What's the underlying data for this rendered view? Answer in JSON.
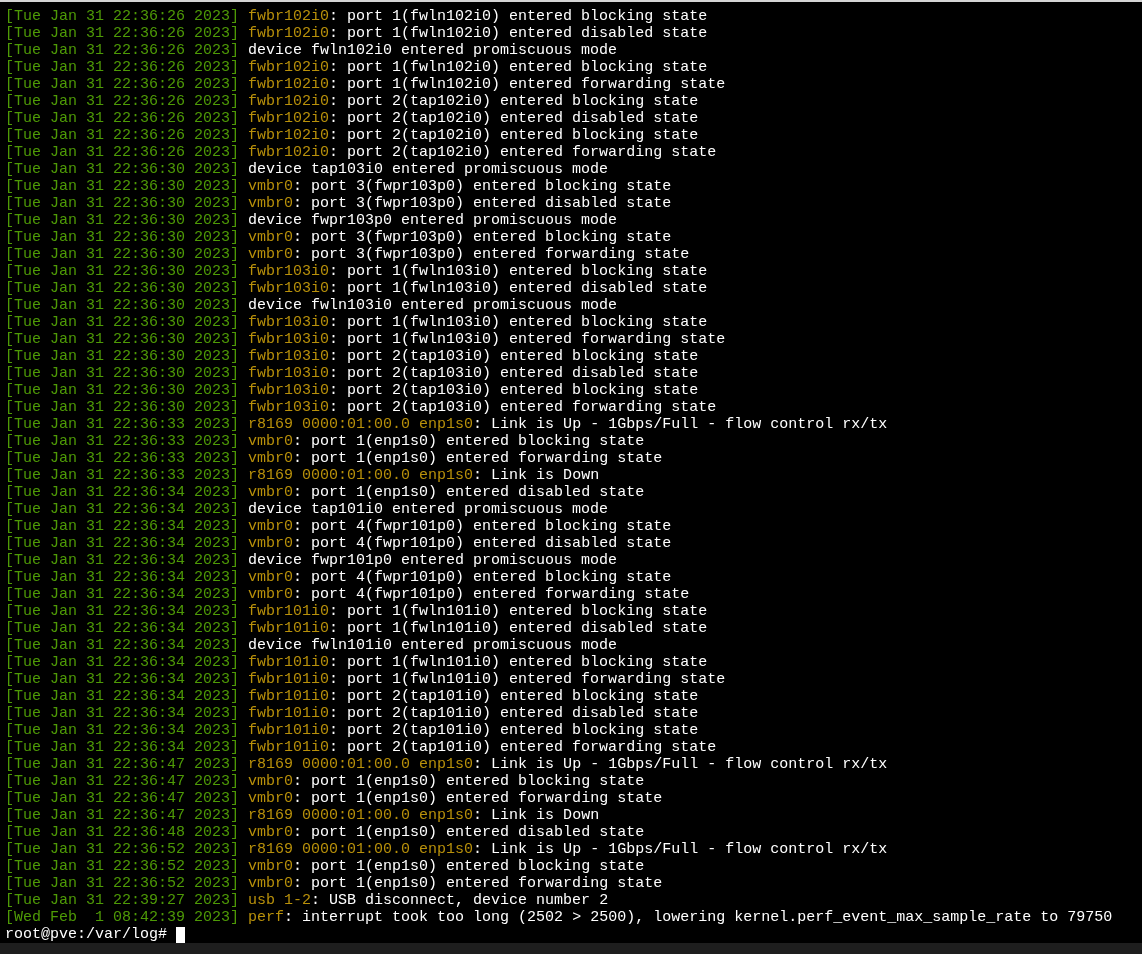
{
  "log_lines": [
    {
      "timestamp": "[Tue Jan 31 22:36:26 2023]",
      "source": "fwbr102i0",
      "message": ": port 1(fwln102i0) entered blocking state"
    },
    {
      "timestamp": "[Tue Jan 31 22:36:26 2023]",
      "source": "fwbr102i0",
      "message": ": port 1(fwln102i0) entered disabled state"
    },
    {
      "timestamp": "[Tue Jan 31 22:36:26 2023]",
      "message": "device fwln102i0 entered promiscuous mode"
    },
    {
      "timestamp": "[Tue Jan 31 22:36:26 2023]",
      "source": "fwbr102i0",
      "message": ": port 1(fwln102i0) entered blocking state"
    },
    {
      "timestamp": "[Tue Jan 31 22:36:26 2023]",
      "source": "fwbr102i0",
      "message": ": port 1(fwln102i0) entered forwarding state"
    },
    {
      "timestamp": "[Tue Jan 31 22:36:26 2023]",
      "source": "fwbr102i0",
      "message": ": port 2(tap102i0) entered blocking state"
    },
    {
      "timestamp": "[Tue Jan 31 22:36:26 2023]",
      "source": "fwbr102i0",
      "message": ": port 2(tap102i0) entered disabled state"
    },
    {
      "timestamp": "[Tue Jan 31 22:36:26 2023]",
      "source": "fwbr102i0",
      "message": ": port 2(tap102i0) entered blocking state"
    },
    {
      "timestamp": "[Tue Jan 31 22:36:26 2023]",
      "source": "fwbr102i0",
      "message": ": port 2(tap102i0) entered forwarding state"
    },
    {
      "timestamp": "[Tue Jan 31 22:36:30 2023]",
      "message": "device tap103i0 entered promiscuous mode"
    },
    {
      "timestamp": "[Tue Jan 31 22:36:30 2023]",
      "source": "vmbr0",
      "message": ": port 3(fwpr103p0) entered blocking state"
    },
    {
      "timestamp": "[Tue Jan 31 22:36:30 2023]",
      "source": "vmbr0",
      "message": ": port 3(fwpr103p0) entered disabled state"
    },
    {
      "timestamp": "[Tue Jan 31 22:36:30 2023]",
      "message": "device fwpr103p0 entered promiscuous mode"
    },
    {
      "timestamp": "[Tue Jan 31 22:36:30 2023]",
      "source": "vmbr0",
      "message": ": port 3(fwpr103p0) entered blocking state"
    },
    {
      "timestamp": "[Tue Jan 31 22:36:30 2023]",
      "source": "vmbr0",
      "message": ": port 3(fwpr103p0) entered forwarding state"
    },
    {
      "timestamp": "[Tue Jan 31 22:36:30 2023]",
      "source": "fwbr103i0",
      "message": ": port 1(fwln103i0) entered blocking state"
    },
    {
      "timestamp": "[Tue Jan 31 22:36:30 2023]",
      "source": "fwbr103i0",
      "message": ": port 1(fwln103i0) entered disabled state"
    },
    {
      "timestamp": "[Tue Jan 31 22:36:30 2023]",
      "message": "device fwln103i0 entered promiscuous mode"
    },
    {
      "timestamp": "[Tue Jan 31 22:36:30 2023]",
      "source": "fwbr103i0",
      "message": ": port 1(fwln103i0) entered blocking state"
    },
    {
      "timestamp": "[Tue Jan 31 22:36:30 2023]",
      "source": "fwbr103i0",
      "message": ": port 1(fwln103i0) entered forwarding state"
    },
    {
      "timestamp": "[Tue Jan 31 22:36:30 2023]",
      "source": "fwbr103i0",
      "message": ": port 2(tap103i0) entered blocking state"
    },
    {
      "timestamp": "[Tue Jan 31 22:36:30 2023]",
      "source": "fwbr103i0",
      "message": ": port 2(tap103i0) entered disabled state"
    },
    {
      "timestamp": "[Tue Jan 31 22:36:30 2023]",
      "source": "fwbr103i0",
      "message": ": port 2(tap103i0) entered blocking state"
    },
    {
      "timestamp": "[Tue Jan 31 22:36:30 2023]",
      "source": "fwbr103i0",
      "message": ": port 2(tap103i0) entered forwarding state"
    },
    {
      "timestamp": "[Tue Jan 31 22:36:33 2023]",
      "source": "r8169 0000:01:00.0 enp1s0",
      "message": ": Link is Up - 1Gbps/Full - flow control rx/tx"
    },
    {
      "timestamp": "[Tue Jan 31 22:36:33 2023]",
      "source": "vmbr0",
      "message": ": port 1(enp1s0) entered blocking state"
    },
    {
      "timestamp": "[Tue Jan 31 22:36:33 2023]",
      "source": "vmbr0",
      "message": ": port 1(enp1s0) entered forwarding state"
    },
    {
      "timestamp": "[Tue Jan 31 22:36:33 2023]",
      "source": "r8169 0000:01:00.0 enp1s0",
      "message": ": Link is Down"
    },
    {
      "timestamp": "[Tue Jan 31 22:36:34 2023]",
      "source": "vmbr0",
      "message": ": port 1(enp1s0) entered disabled state"
    },
    {
      "timestamp": "[Tue Jan 31 22:36:34 2023]",
      "message": "device tap101i0 entered promiscuous mode"
    },
    {
      "timestamp": "[Tue Jan 31 22:36:34 2023]",
      "source": "vmbr0",
      "message": ": port 4(fwpr101p0) entered blocking state"
    },
    {
      "timestamp": "[Tue Jan 31 22:36:34 2023]",
      "source": "vmbr0",
      "message": ": port 4(fwpr101p0) entered disabled state"
    },
    {
      "timestamp": "[Tue Jan 31 22:36:34 2023]",
      "message": "device fwpr101p0 entered promiscuous mode"
    },
    {
      "timestamp": "[Tue Jan 31 22:36:34 2023]",
      "source": "vmbr0",
      "message": ": port 4(fwpr101p0) entered blocking state"
    },
    {
      "timestamp": "[Tue Jan 31 22:36:34 2023]",
      "source": "vmbr0",
      "message": ": port 4(fwpr101p0) entered forwarding state"
    },
    {
      "timestamp": "[Tue Jan 31 22:36:34 2023]",
      "source": "fwbr101i0",
      "message": ": port 1(fwln101i0) entered blocking state"
    },
    {
      "timestamp": "[Tue Jan 31 22:36:34 2023]",
      "source": "fwbr101i0",
      "message": ": port 1(fwln101i0) entered disabled state"
    },
    {
      "timestamp": "[Tue Jan 31 22:36:34 2023]",
      "message": "device fwln101i0 entered promiscuous mode"
    },
    {
      "timestamp": "[Tue Jan 31 22:36:34 2023]",
      "source": "fwbr101i0",
      "message": ": port 1(fwln101i0) entered blocking state"
    },
    {
      "timestamp": "[Tue Jan 31 22:36:34 2023]",
      "source": "fwbr101i0",
      "message": ": port 1(fwln101i0) entered forwarding state"
    },
    {
      "timestamp": "[Tue Jan 31 22:36:34 2023]",
      "source": "fwbr101i0",
      "message": ": port 2(tap101i0) entered blocking state"
    },
    {
      "timestamp": "[Tue Jan 31 22:36:34 2023]",
      "source": "fwbr101i0",
      "message": ": port 2(tap101i0) entered disabled state"
    },
    {
      "timestamp": "[Tue Jan 31 22:36:34 2023]",
      "source": "fwbr101i0",
      "message": ": port 2(tap101i0) entered blocking state"
    },
    {
      "timestamp": "[Tue Jan 31 22:36:34 2023]",
      "source": "fwbr101i0",
      "message": ": port 2(tap101i0) entered forwarding state"
    },
    {
      "timestamp": "[Tue Jan 31 22:36:47 2023]",
      "source": "r8169 0000:01:00.0 enp1s0",
      "message": ": Link is Up - 1Gbps/Full - flow control rx/tx"
    },
    {
      "timestamp": "[Tue Jan 31 22:36:47 2023]",
      "source": "vmbr0",
      "message": ": port 1(enp1s0) entered blocking state"
    },
    {
      "timestamp": "[Tue Jan 31 22:36:47 2023]",
      "source": "vmbr0",
      "message": ": port 1(enp1s0) entered forwarding state"
    },
    {
      "timestamp": "[Tue Jan 31 22:36:47 2023]",
      "source": "r8169 0000:01:00.0 enp1s0",
      "message": ": Link is Down"
    },
    {
      "timestamp": "[Tue Jan 31 22:36:48 2023]",
      "source": "vmbr0",
      "message": ": port 1(enp1s0) entered disabled state"
    },
    {
      "timestamp": "[Tue Jan 31 22:36:52 2023]",
      "source": "r8169 0000:01:00.0 enp1s0",
      "message": ": Link is Up - 1Gbps/Full - flow control rx/tx"
    },
    {
      "timestamp": "[Tue Jan 31 22:36:52 2023]",
      "source": "vmbr0",
      "message": ": port 1(enp1s0) entered blocking state"
    },
    {
      "timestamp": "[Tue Jan 31 22:36:52 2023]",
      "source": "vmbr0",
      "message": ": port 1(enp1s0) entered forwarding state"
    },
    {
      "timestamp": "[Tue Jan 31 22:39:27 2023]",
      "source": "usb 1-2",
      "message": ": USB disconnect, device number 2"
    },
    {
      "timestamp": "[Wed Feb  1 08:42:39 2023]",
      "source": "perf",
      "message": ": interrupt took too long (2502 > 2500), lowering kernel.perf_event_max_sample_rate to 79750"
    }
  ],
  "prompt": "root@pve:/var/log#"
}
